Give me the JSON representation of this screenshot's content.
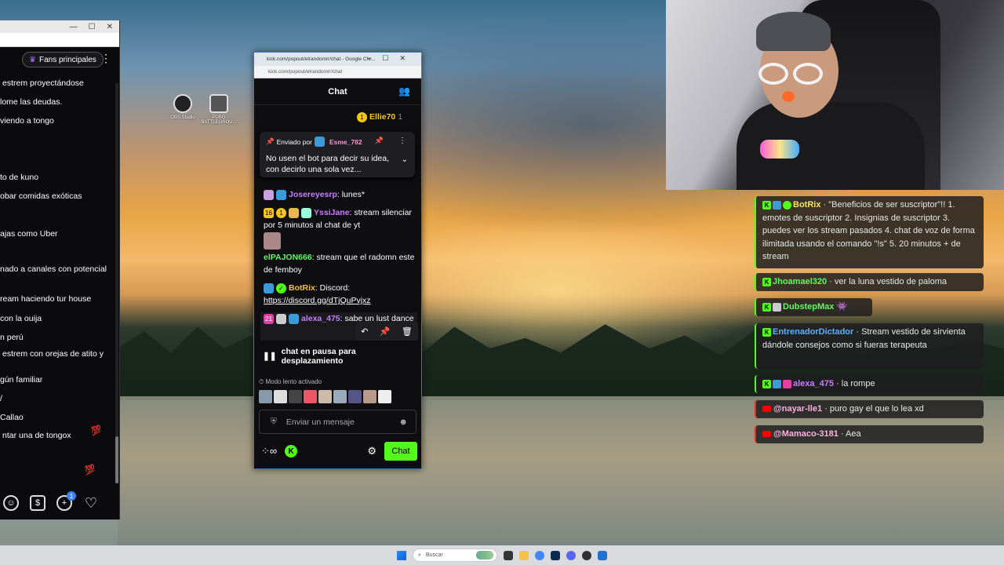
{
  "left_window": {
    "fans_label": "Fans principales",
    "messages": [
      "estrem proyectándose",
      "lome las deudas.",
      "viendo a tongo",
      "to de kuno",
      "obar comidas exóticas",
      "ajas como Uber",
      "nado a canales con potencial",
      "ream haciendo tur house",
      "con la ouija",
      "n perú",
      "estrem con orejas de atito y",
      "gún familiar",
      "/",
      "Callao",
      "ntar una de tongox"
    ],
    "notif_count": "1"
  },
  "desktop_icons": [
    {
      "label": "OBS Studio"
    },
    {
      "label": "PUBG BATTLEGROU..."
    }
  ],
  "chat_window": {
    "title": "kick.com/popout/elrandomrr/chat - Google Chr...",
    "url": "kick.com/popout/elrandomrr/chat",
    "header": "Chat",
    "top_user": "Ellie70",
    "top_user_count": "1",
    "pinned": {
      "sent_by": "Enviado por",
      "author": "Esme_782",
      "text": "No usen el bot para decir su idea, con decirlo una sola vez..."
    },
    "messages": [
      {
        "user": "Josereyesrp",
        "text": ": lunes*"
      },
      {
        "user": "YssiJane",
        "badges": [
          "16",
          "1"
        ],
        "text": ": stream silenciar por 5 minutos al chat de yt"
      },
      {
        "user": "elPAJON666",
        "text": ": stream que el radomn este de femboy"
      },
      {
        "user": "BotRix",
        "text": ": Discord:",
        "link": "https://discord.gg/dTjQuPvjxz"
      },
      {
        "user": "alexa_475",
        "badges": [
          "21"
        ],
        "text": ": sabe un lust dance"
      }
    ],
    "pause_label": "chat en pausa para desplazamiento",
    "slow_mode": "Modo lento activado",
    "input_placeholder": "Enviar un mensaje",
    "chat_button": "Chat"
  },
  "overlay_chat": [
    {
      "user": "BotRix",
      "text": " · \"Beneficios de ser suscriptor\"!! 1. emotes de suscriptor 2. Insignias de suscriptor 3. puedes ver los stream pasados 4. chat de voz de forma ilimitada usando el comando \"!s\" 5. 20 minutos + de stream",
      "platform": "kick"
    },
    {
      "user": "Jhoamael320",
      "text": " · ver la luna vestido de paloma",
      "platform": "kick"
    },
    {
      "user": "DubstepMax",
      "text": "",
      "platform": "kick"
    },
    {
      "user": "EntrenadorDictador",
      "text": " · Stream vestido de sirvienta dándole consejos como si fueras terapeuta",
      "platform": "kick"
    },
    {
      "user": "alexa_475",
      "text": " · la rompe",
      "platform": "kick"
    },
    {
      "user": "@nayar-lle1",
      "text": " · puro gay el que lo lea xd",
      "platform": "youtube"
    },
    {
      "user": "@Mamaco-3181",
      "text": " · Aea",
      "platform": "youtube"
    }
  ],
  "taskbar": {
    "search_placeholder": "Buscar"
  },
  "colors": {
    "kick_green": "#53fc18",
    "youtube_red": "#ff0000",
    "accent_purple": "#a970ff"
  }
}
